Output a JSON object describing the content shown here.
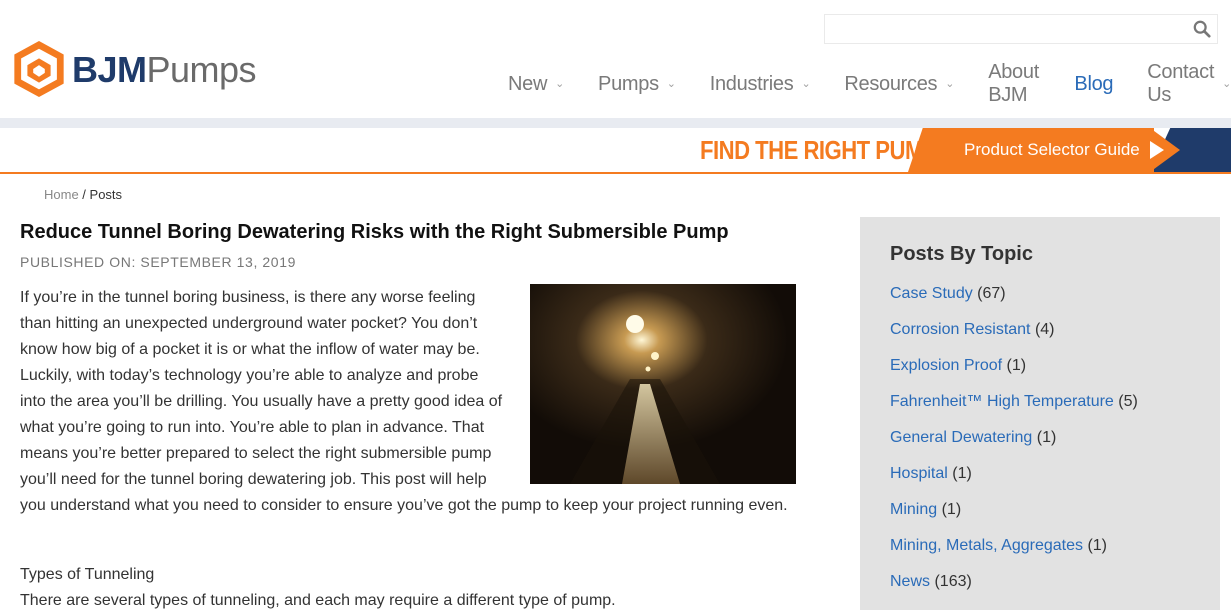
{
  "brand": {
    "bjm": "BJM",
    "pumps": "Pumps"
  },
  "search": {
    "placeholder": "",
    "value": ""
  },
  "nav": [
    {
      "label": "New",
      "has_dropdown": true,
      "active": false
    },
    {
      "label": "Pumps",
      "has_dropdown": true,
      "active": false
    },
    {
      "label": "Industries",
      "has_dropdown": true,
      "active": false
    },
    {
      "label": "Resources",
      "has_dropdown": true,
      "active": false
    },
    {
      "label": "About BJM",
      "has_dropdown": false,
      "active": false
    },
    {
      "label": "Blog",
      "has_dropdown": false,
      "active": true
    },
    {
      "label": "Contact Us",
      "has_dropdown": true,
      "active": false
    }
  ],
  "banner": {
    "title": "FIND THE RIGHT PUMP",
    "button": "Product Selector Guide"
  },
  "breadcrumb": {
    "home": "Home",
    "separator": " / ",
    "current": "Posts"
  },
  "article": {
    "title": "Reduce Tunnel Boring Dewatering Risks with the Right Submersible Pump",
    "published": "PUBLISHED ON: SEPTEMBER 13, 2019",
    "intro": "If you’re in the tunnel boring business, is there any worse feeling than hitting an unexpected underground water pocket? You don’t know how big of a pocket it is or what the inflow of water may be. Luckily, with today’s technology you’re able to analyze and probe into the area you’ll be drilling. You usually have a pretty good idea of what you’re going to run into. You’re able to plan in advance. That means you’re better prepared to select the right submersible pump you’ll need for the tunnel boring dewatering job. This post will help you understand what you need to consider to ensure you’ve got the pump to keep your project running even.",
    "subheading": "Types of Tunneling",
    "paragraph2": "There are several types of tunneling, and each may require a different type of pump."
  },
  "sidebar": {
    "title": "Posts By Topic",
    "topics": [
      {
        "name": "Case Study",
        "count": "(67)"
      },
      {
        "name": "Corrosion Resistant",
        "count": "(4)"
      },
      {
        "name": "Explosion Proof",
        "count": "(1)"
      },
      {
        "name": "Fahrenheit™ High Temperature",
        "count": "(5)"
      },
      {
        "name": "General Dewatering",
        "count": "(1)"
      },
      {
        "name": "Hospital",
        "count": "(1)"
      },
      {
        "name": "Mining",
        "count": "(1)"
      },
      {
        "name": "Mining, Metals, Aggregates",
        "count": "(1)"
      },
      {
        "name": "News",
        "count": "(163)"
      }
    ]
  },
  "colors": {
    "orange": "#f47b20",
    "navy": "#1f3b6a",
    "link": "#2a6bb8",
    "sidebar_bg": "#e2e2e2"
  },
  "icons": {
    "search": "search-icon",
    "dropdown": "chevron-down-icon",
    "banner_arrow": "play-arrow-icon"
  }
}
